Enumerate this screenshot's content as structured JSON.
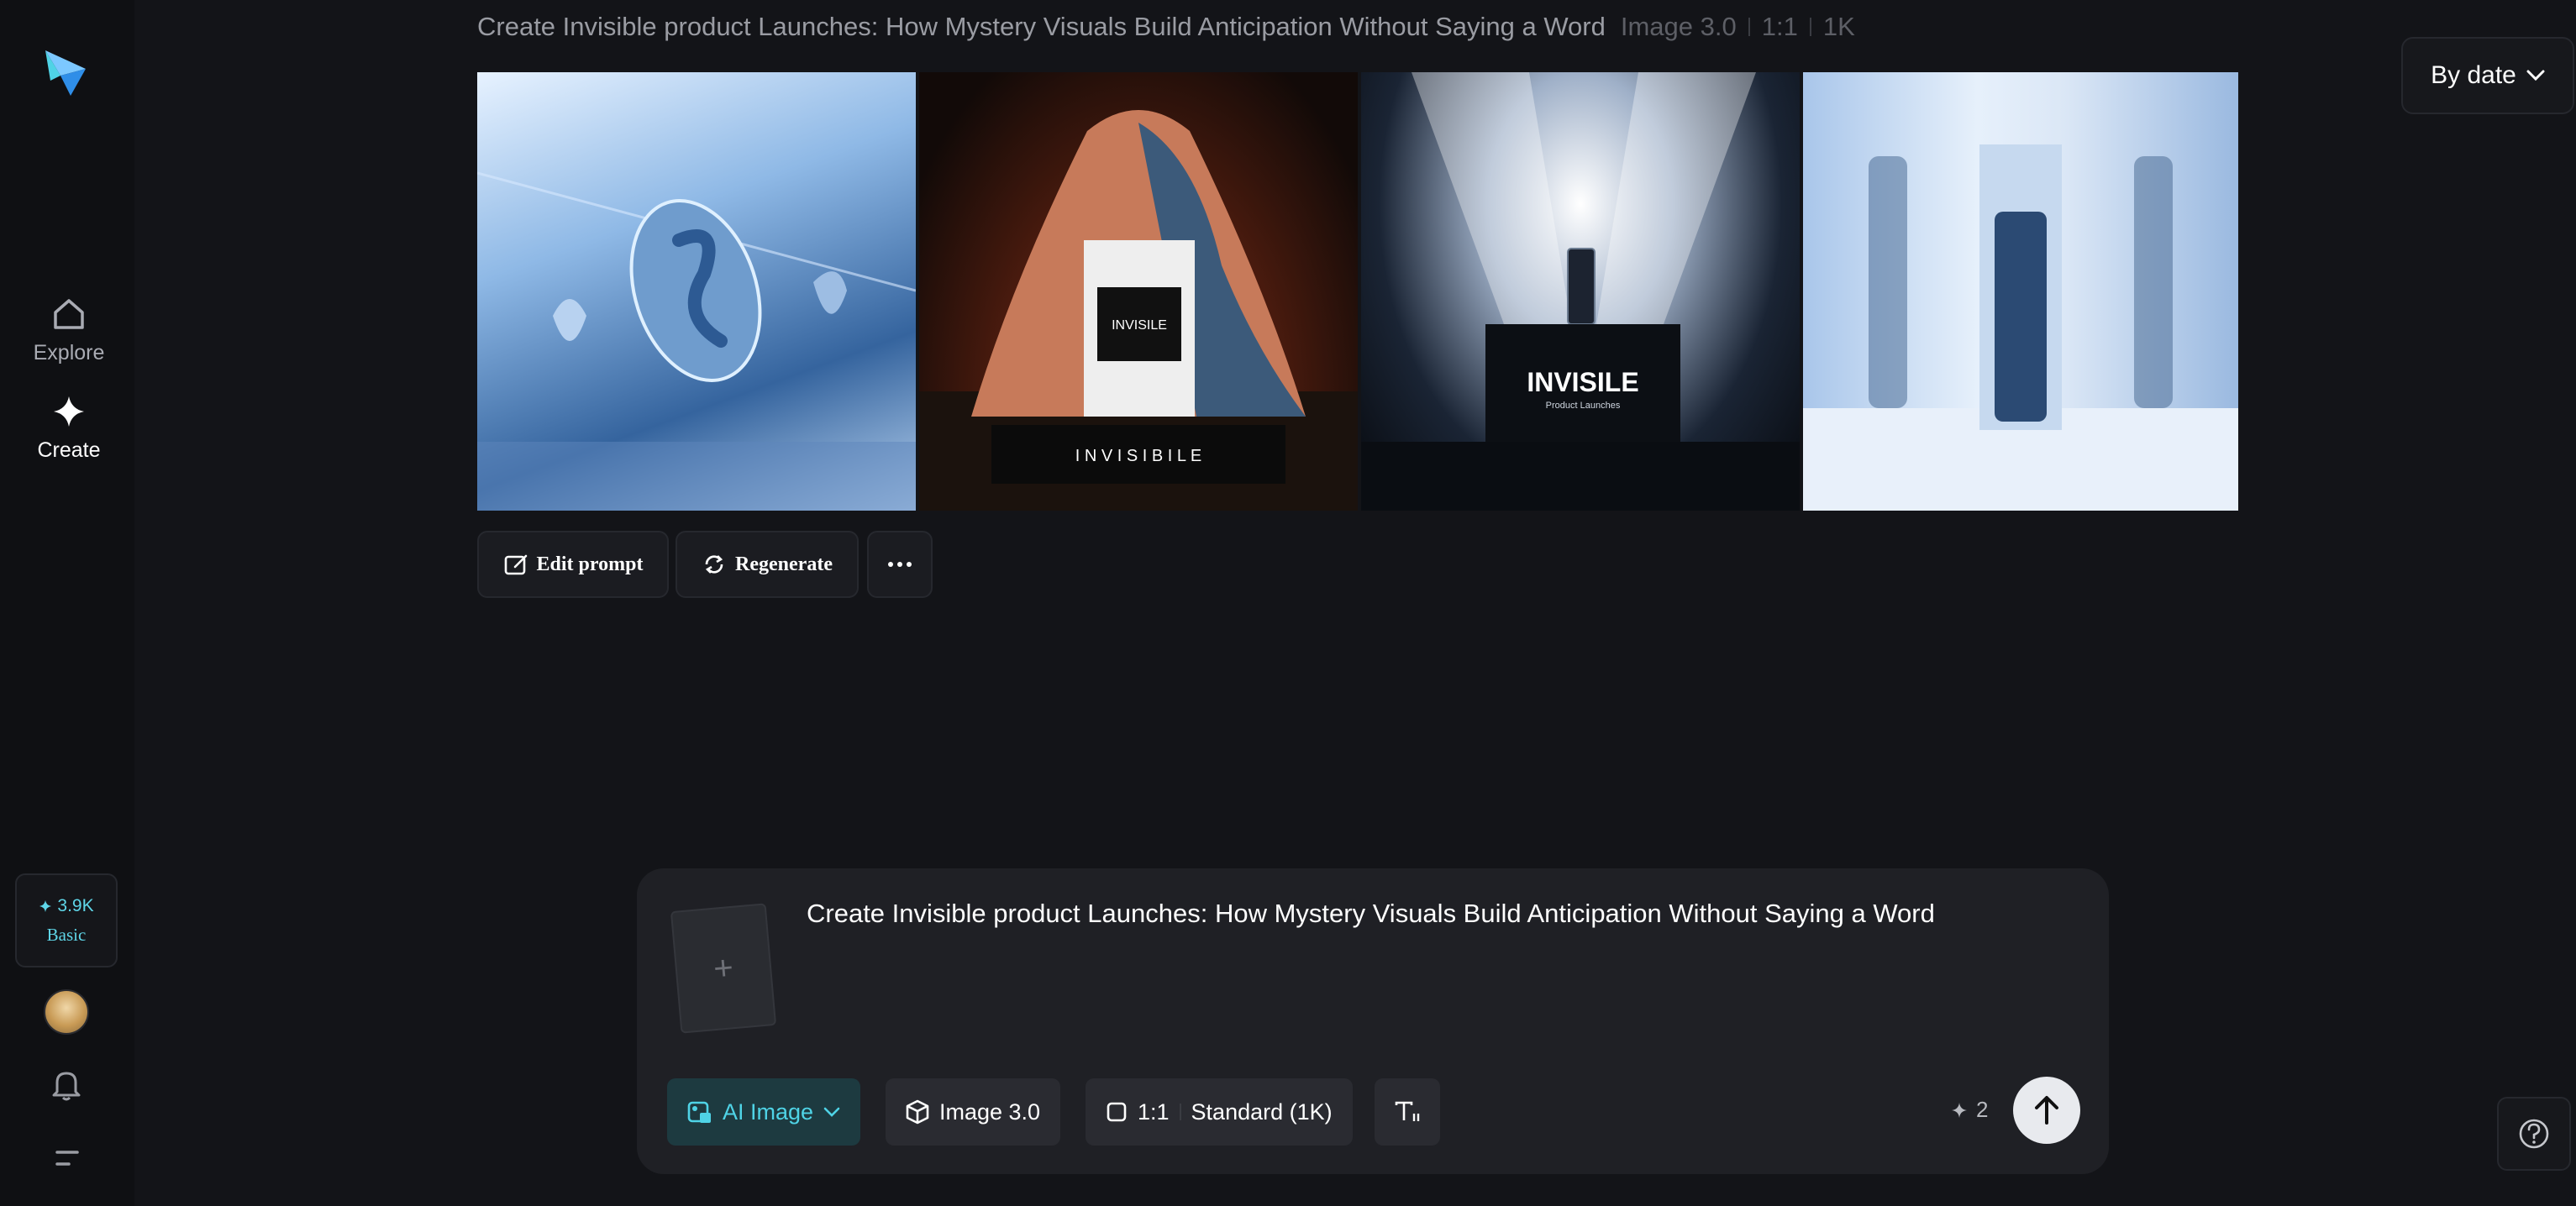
{
  "sidebar": {
    "nav": [
      {
        "label": "Explore",
        "icon": "home-icon"
      },
      {
        "label": "Create",
        "icon": "sparkle-icon"
      }
    ],
    "credits": {
      "amount": "3.9K",
      "tier": "Basic"
    }
  },
  "generation": {
    "title": "Create Invisible product Launches: How Mystery Visuals Build Anticipation Without Saying a Word",
    "model": "Image 3.0",
    "ratio": "1:1",
    "resolution": "1K",
    "images": [
      {
        "overlay_text": ""
      },
      {
        "overlay_text": "INVISILE",
        "caption": "I N V I S I B I L E"
      },
      {
        "overlay_text": "INVISILE",
        "caption": "Product Launches"
      },
      {
        "overlay_text": ""
      }
    ],
    "actions": {
      "edit": "Edit prompt",
      "regenerate": "Regenerate"
    }
  },
  "sort": {
    "label": "By date"
  },
  "prompt_panel": {
    "prompt": "Create Invisible product Launches: How Mystery Visuals Build Anticipation Without Saying a Word",
    "mode": "AI Image",
    "model": "Image 3.0",
    "ratio": "1:1",
    "quality": "Standard (1K)",
    "cost": "2"
  },
  "colors": {
    "accent": "#4fd3e6",
    "background": "#131418",
    "panel": "#1f2025"
  }
}
